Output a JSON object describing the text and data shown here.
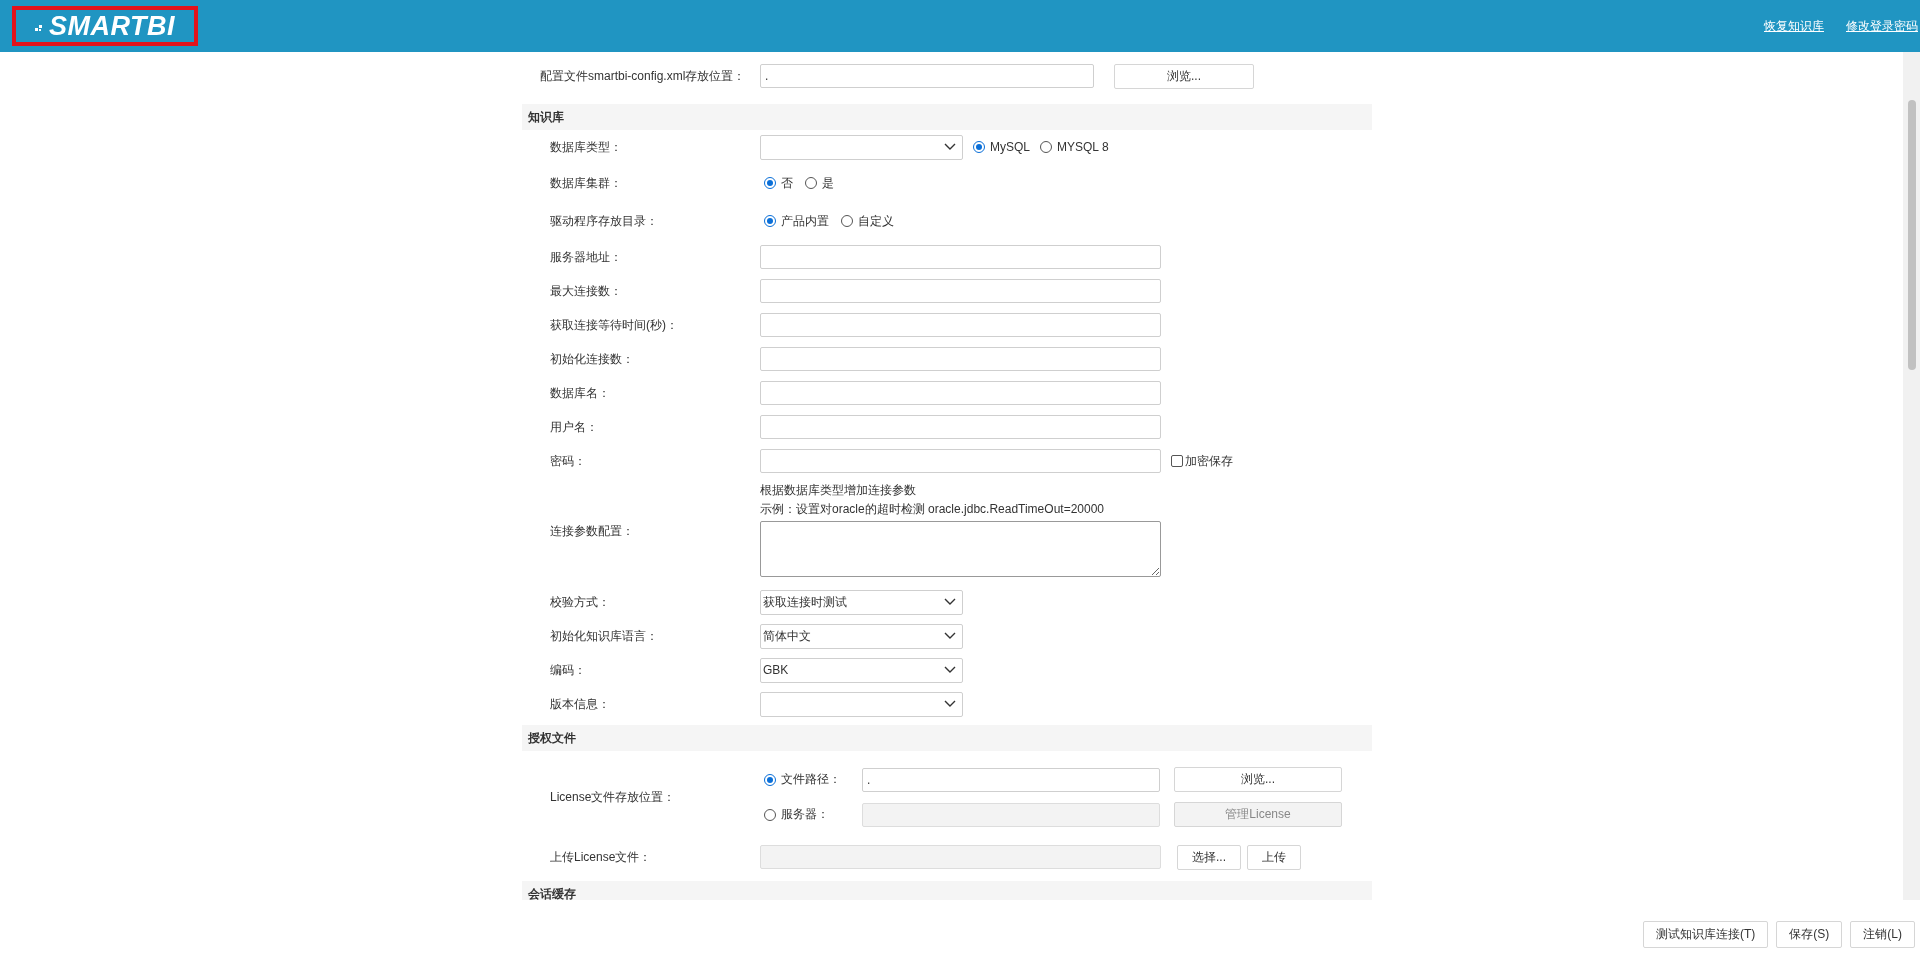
{
  "header": {
    "logo": "SMARTBI",
    "links": [
      "恢复知识库",
      "修改登录密码"
    ]
  },
  "config_file": {
    "label": "配置文件smartbi-config.xml存放位置：",
    "value": ".",
    "button": "浏览..."
  },
  "sections": [
    {
      "title": "知识库",
      "rows": [
        {
          "kind": "select_radio",
          "label": "数据库类型：",
          "options": [
            {
              "label": "MySQL",
              "selected": true
            },
            {
              "label": "MYSQL 8",
              "selected": false
            }
          ]
        },
        {
          "kind": "radio",
          "label": "数据库集群：",
          "options": [
            {
              "label": "否",
              "selected": true
            },
            {
              "label": "是",
              "selected": false
            }
          ]
        },
        {
          "kind": "radio",
          "label": "驱动程序存放目录：",
          "options": [
            {
              "label": "产品内置",
              "selected": true
            },
            {
              "label": "自定义",
              "selected": false
            }
          ]
        },
        {
          "kind": "text",
          "label": "服务器地址："
        },
        {
          "kind": "text",
          "label": "最大连接数："
        },
        {
          "kind": "text",
          "label": "获取连接等待时间(秒)："
        },
        {
          "kind": "text",
          "label": "初始化连接数："
        },
        {
          "kind": "text",
          "label": "数据库名："
        },
        {
          "kind": "text",
          "label": "用户名："
        },
        {
          "kind": "password",
          "label": "密码：",
          "checkbox": {
            "label": "加密保存",
            "checked": false
          }
        },
        {
          "kind": "textarea",
          "label": "连接参数配置：",
          "hints": [
            "根据数据库类型增加连接参数",
            "示例：设置对oracle的超时检测 oracle.jdbc.ReadTimeOut=20000"
          ]
        },
        {
          "kind": "select",
          "label": "校验方式：",
          "value": "获取连接时测试"
        },
        {
          "kind": "select",
          "label": "初始化知识库语言：",
          "value": "简体中文"
        },
        {
          "kind": "select",
          "label": "编码：",
          "value": "GBK"
        },
        {
          "kind": "select",
          "label": "版本信息："
        }
      ]
    },
    {
      "title": "授权文件",
      "rows": [
        {
          "kind": "license",
          "label": "License文件存放位置：",
          "options": [
            {
              "label": "文件路径：",
              "selected": true,
              "value": ".",
              "button": "浏览...",
              "disabled": false
            },
            {
              "label": "服务器：",
              "selected": false,
              "button": "管理License",
              "disabled": true
            }
          ]
        },
        {
          "kind": "upload",
          "label": "上传License文件：",
          "buttons": [
            "选择...",
            "上传"
          ]
        }
      ]
    },
    {
      "title": "会话缓存"
    }
  ],
  "footer_buttons": [
    "测试知识库连接(T)",
    "保存(S)",
    "注销(L)"
  ]
}
